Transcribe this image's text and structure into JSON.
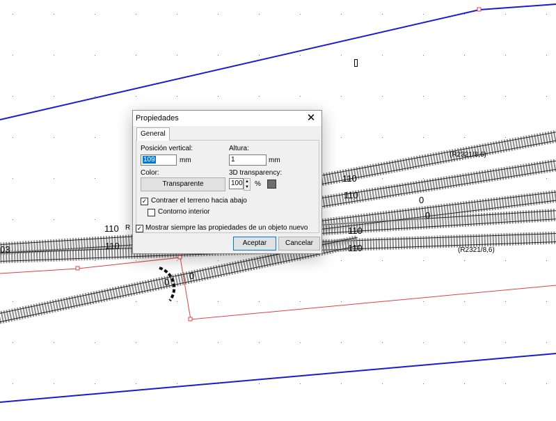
{
  "canvas": {
    "track_labels": [
      "110",
      "110",
      "110",
      "110",
      "110",
      "110",
      "0",
      "0",
      "0",
      "0",
      "03"
    ],
    "radius_labels": [
      "(R2321/8,6)",
      "(R2321/8,6)"
    ],
    "partial_label": "R"
  },
  "dialog": {
    "title": "Propiedades",
    "close_glyph": "✕",
    "tab_general": "General",
    "vertical_position_label": "Posición vertical:",
    "vertical_position_value": "109",
    "vertical_position_unit": "mm",
    "height_label": "Altura:",
    "height_value": "1",
    "height_unit": "mm",
    "color_label": "Color:",
    "color_button": "Transparente",
    "transparency_label": "3D transparency:",
    "transparency_value": "100",
    "transparency_unit": "%",
    "transparency_swatch_color": "#6e6e6e",
    "contract_terrain_label": "Contraer el terreno hacia abajo",
    "contract_terrain_checked": true,
    "inner_contour_label": "Contorno interior",
    "inner_contour_checked": false,
    "always_show_label": "Mostrar siempre las propiedades de un objeto nuevo",
    "always_show_checked": true,
    "accept_button": "Aceptar",
    "cancel_button": "Cancelar"
  },
  "colors": {
    "boundary_blue": "#1a1ad0",
    "selection_red": "#e04040",
    "tie_gray": "#8c8c8c"
  }
}
